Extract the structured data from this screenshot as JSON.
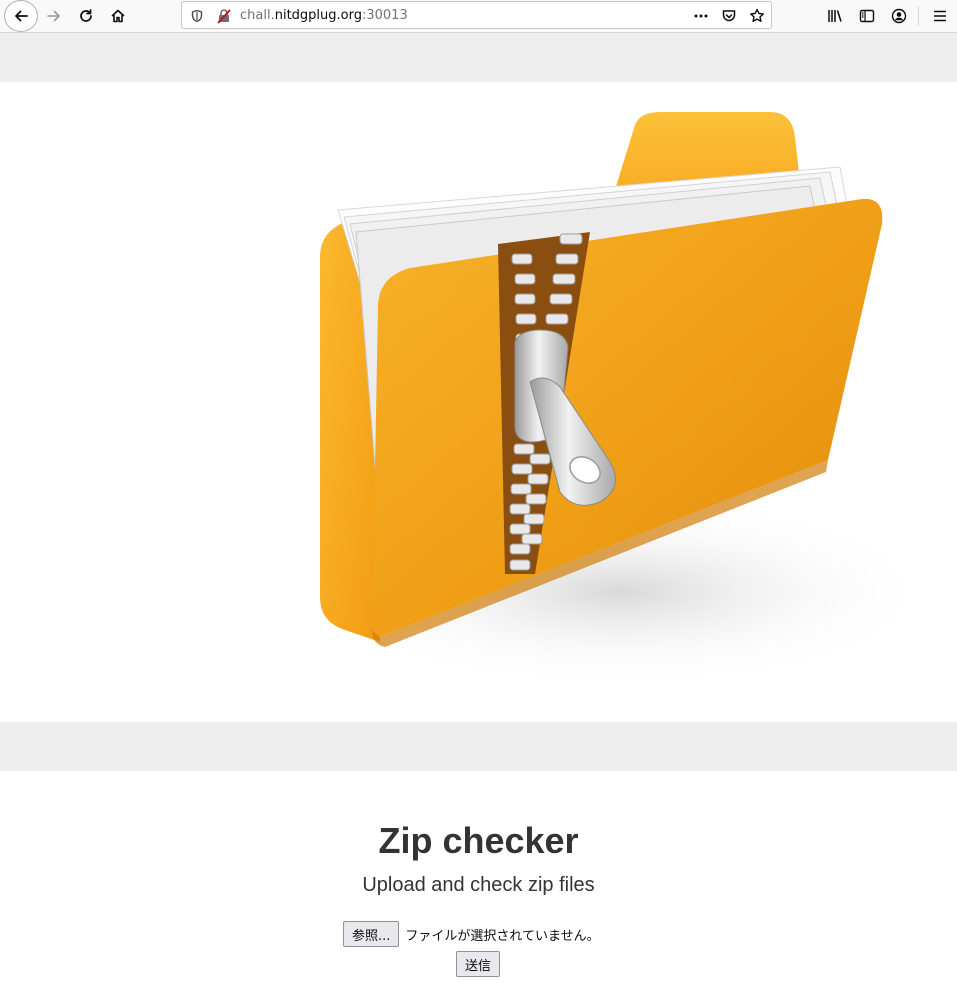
{
  "browser": {
    "url_prefix": "chall.",
    "url_host": "nitdgplug.org",
    "url_suffix": ":30013"
  },
  "page": {
    "hero_image_alt": "zipped folder",
    "title": "Zip checker",
    "subtitle": "Upload and check zip files",
    "browse_button": "参照...",
    "file_status": "ファイルが選択されていません。",
    "submit_button": "送信"
  },
  "colors": {
    "folder_orange": "#f0a21a",
    "band_gray": "#eeeeee",
    "text": "#333333"
  }
}
